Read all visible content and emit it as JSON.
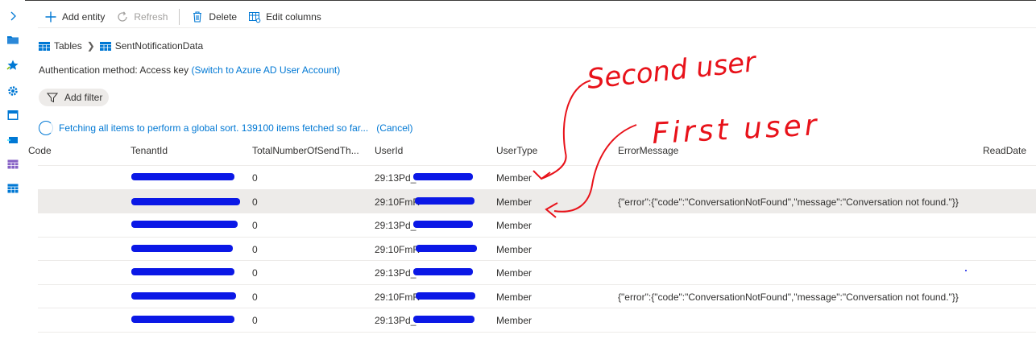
{
  "toolbar": {
    "add_entity": "Add entity",
    "refresh": "Refresh",
    "delete": "Delete",
    "edit_columns": "Edit columns"
  },
  "breadcrumb": {
    "root": "Tables",
    "current": "SentNotificationData"
  },
  "auth": {
    "label": "Authentication method:",
    "value": "Access key",
    "switch_link": "(Switch to Azure AD User Account)"
  },
  "filter": {
    "label": "Add filter"
  },
  "status": {
    "fetching": "Fetching all items to perform a global sort. 139100 items fetched so far...",
    "cancel": "(Cancel)"
  },
  "table": {
    "columns": [
      "Code",
      "TenantId",
      "TotalNumberOfSendTh...",
      "UserId",
      "UserType",
      "ErrorMessage",
      "ReadDate"
    ],
    "rows": [
      {
        "total": "0",
        "userid": "29:13Pd_",
        "usertype": "Member",
        "error": ""
      },
      {
        "total": "0",
        "userid": "29:10FmR",
        "usertype": "Member",
        "error": "{\"error\":{\"code\":\"ConversationNotFound\",\"message\":\"Conversation not found.\"}}"
      },
      {
        "total": "0",
        "userid": "29:13Pd_",
        "usertype": "Member",
        "error": ""
      },
      {
        "total": "0",
        "userid": "29:10FmR",
        "usertype": "Member",
        "error": ""
      },
      {
        "total": "0",
        "userid": "29:13Pd_",
        "usertype": "Member",
        "error": ""
      },
      {
        "total": "0",
        "userid": "29:10FmR",
        "usertype": "Member",
        "error": "{\"error\":{\"code\":\"ConversationNotFound\",\"message\":\"Conversation not found.\"}}"
      },
      {
        "total": "0",
        "userid": "29:13Pd_",
        "usertype": "Member",
        "error": ""
      }
    ]
  },
  "annotations": {
    "second": "Second user",
    "first": "First user"
  },
  "colors": {
    "accent": "#0078d4",
    "annotation": "#e8121a",
    "redaction": "#0b18e6",
    "selected_row": "#edebe9"
  }
}
